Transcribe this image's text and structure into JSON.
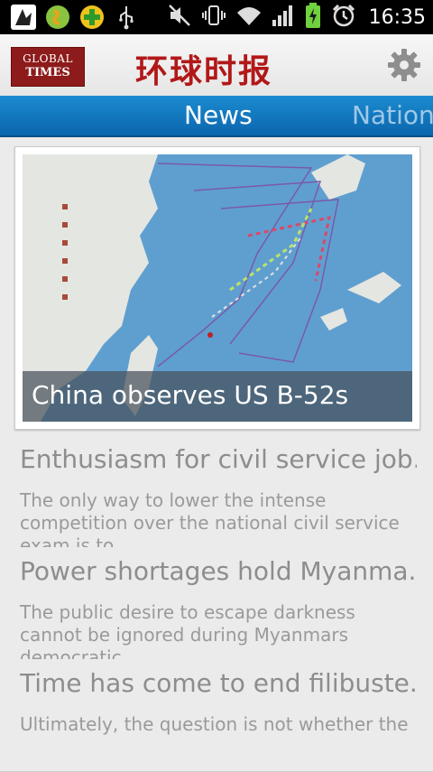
{
  "status_bar": {
    "time": "16:35",
    "icons": [
      "app-notification-icon",
      "green-app-icon",
      "add-icon",
      "usb-icon",
      "mute-icon",
      "vibrate-icon",
      "wifi-icon",
      "signal-icon",
      "battery-charging-icon",
      "alarm-icon"
    ]
  },
  "app": {
    "logo_line1": "GLOBAL",
    "logo_line2": "TIMES",
    "brand_title": "环球时报",
    "settings_icon": "gear-icon"
  },
  "tabs": {
    "active": "News",
    "next": "Nation"
  },
  "featured": {
    "caption": "China observes US B-52s"
  },
  "articles": [
    {
      "title": "Enthusiasm for civil service job...",
      "summary": "The only way to lower the intense competition over the national civil service exam is to"
    },
    {
      "title": "Power shortages hold Myanma...",
      "summary": "The public desire to escape darkness cannot be ignored during Myanmars democratic"
    },
    {
      "title": "Time has come to end filibuste...",
      "summary": "Ultimately, the question is not whether the"
    }
  ],
  "colors": {
    "tab_bar": "#0b66ad",
    "brand_red": "#b21818",
    "status_bar": "#000000"
  }
}
